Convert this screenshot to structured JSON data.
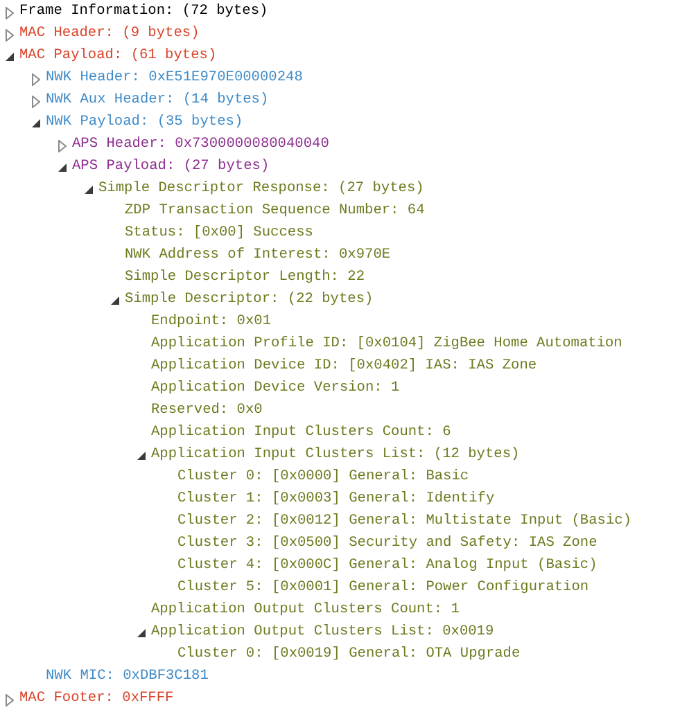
{
  "tree": [
    {
      "label": "Frame Information: (72 bytes)",
      "color": "#000000",
      "expanded": false
    },
    {
      "label": "MAC Header: (9 bytes)",
      "color": "#d9452b",
      "expanded": false
    },
    {
      "label": "MAC Payload: (61 bytes)",
      "color": "#d9452b",
      "expanded": true,
      "children": [
        {
          "label": "NWK Header: 0xE51E970E00000248",
          "color": "#3f8cc9",
          "expanded": false
        },
        {
          "label": "NWK Aux Header: (14 bytes)",
          "color": "#3f8cc9",
          "expanded": false
        },
        {
          "label": "NWK Payload: (35 bytes)",
          "color": "#3f8cc9",
          "expanded": true,
          "children": [
            {
              "label": "APS Header: 0x7300000080040040",
              "color": "#8e2f8f",
              "expanded": false
            },
            {
              "label": "APS Payload: (27 bytes)",
              "color": "#8e2f8f",
              "expanded": true,
              "children": [
                {
                  "label": "Simple Descriptor Response: (27 bytes)",
                  "color": "#6f7a1f",
                  "expanded": true,
                  "children": [
                    {
                      "label": "ZDP Transaction Sequence Number: 64",
                      "color": "#6f7a1f"
                    },
                    {
                      "label": "Status: [0x00] Success",
                      "color": "#6f7a1f"
                    },
                    {
                      "label": "NWK Address of Interest: 0x970E",
                      "color": "#6f7a1f"
                    },
                    {
                      "label": "Simple Descriptor Length: 22",
                      "color": "#6f7a1f"
                    },
                    {
                      "label": "Simple Descriptor: (22 bytes)",
                      "color": "#6f7a1f",
                      "expanded": true,
                      "children": [
                        {
                          "label": "Endpoint: 0x01",
                          "color": "#6f7a1f"
                        },
                        {
                          "label": "Application Profile ID: [0x0104] ZigBee Home Automation",
                          "color": "#6f7a1f"
                        },
                        {
                          "label": "Application Device ID: [0x0402] IAS: IAS Zone",
                          "color": "#6f7a1f"
                        },
                        {
                          "label": "Application Device Version: 1",
                          "color": "#6f7a1f"
                        },
                        {
                          "label": "Reserved: 0x0",
                          "color": "#6f7a1f"
                        },
                        {
                          "label": "Application Input Clusters Count: 6",
                          "color": "#6f7a1f"
                        },
                        {
                          "label": "Application Input Clusters List: (12 bytes)",
                          "color": "#6f7a1f",
                          "expanded": true,
                          "children": [
                            {
                              "label": "Cluster 0: [0x0000] General: Basic",
                              "color": "#6f7a1f"
                            },
                            {
                              "label": "Cluster 1: [0x0003] General: Identify",
                              "color": "#6f7a1f"
                            },
                            {
                              "label": "Cluster 2: [0x0012] General: Multistate Input (Basic)",
                              "color": "#6f7a1f"
                            },
                            {
                              "label": "Cluster 3: [0x0500] Security and Safety: IAS Zone",
                              "color": "#6f7a1f"
                            },
                            {
                              "label": "Cluster 4: [0x000C] General: Analog Input (Basic)",
                              "color": "#6f7a1f"
                            },
                            {
                              "label": "Cluster 5: [0x0001] General: Power Configuration",
                              "color": "#6f7a1f"
                            }
                          ]
                        },
                        {
                          "label": "Application Output Clusters Count: 1",
                          "color": "#6f7a1f"
                        },
                        {
                          "label": "Application Output Clusters List: 0x0019",
                          "color": "#6f7a1f",
                          "expanded": true,
                          "children": [
                            {
                              "label": "Cluster 0: [0x0019] General: OTA Upgrade",
                              "color": "#6f7a1f"
                            }
                          ]
                        }
                      ]
                    }
                  ]
                }
              ]
            }
          ]
        },
        {
          "label": "NWK MIC: 0xDBF3C181",
          "color": "#3f8cc9"
        }
      ]
    },
    {
      "label": "MAC Footer: 0xFFFF",
      "color": "#d9452b",
      "expanded": false
    }
  ]
}
